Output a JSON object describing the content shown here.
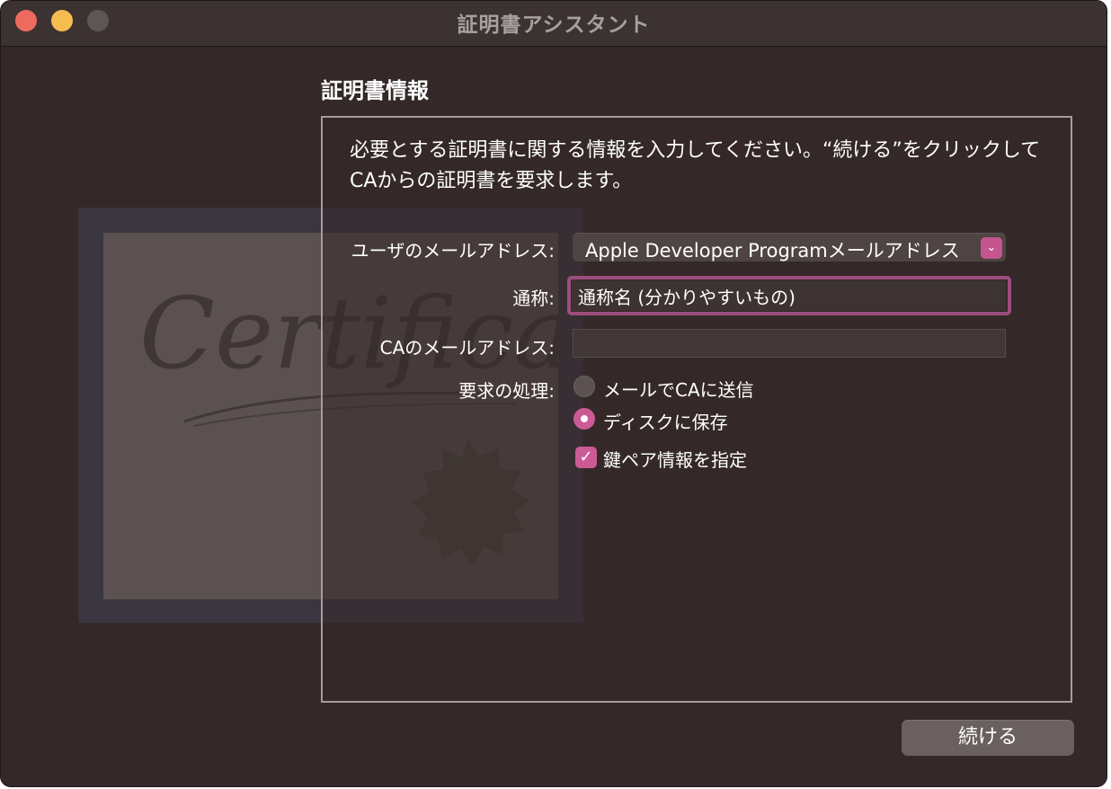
{
  "window": {
    "title": "証明書アシスタント"
  },
  "section_title": "証明書情報",
  "description": "必要とする証明書に関する情報を入力してください。“続ける”をクリックしてCAからの証明書を要求します。",
  "illustration": {
    "text": "Certificate"
  },
  "form": {
    "email_label": "ユーザのメールアドレス:",
    "email_value": "Apple Developer Programメールアドレス",
    "common_name_label": "通称:",
    "common_name_value": "通称名 (分かりやすいもの)",
    "ca_email_label": "CAのメールアドレス:",
    "ca_email_value": "",
    "request_label": "要求の処理:",
    "options": [
      {
        "label": "メールでCAに送信",
        "selected": false
      },
      {
        "label": "ディスクに保存",
        "selected": true
      }
    ],
    "key_pair_label": "鍵ペア情報を指定",
    "key_pair_checked": true
  },
  "buttons": {
    "continue_label": "続ける"
  },
  "colors": {
    "accent": "#cc5b95",
    "window_bg": "#342928"
  }
}
